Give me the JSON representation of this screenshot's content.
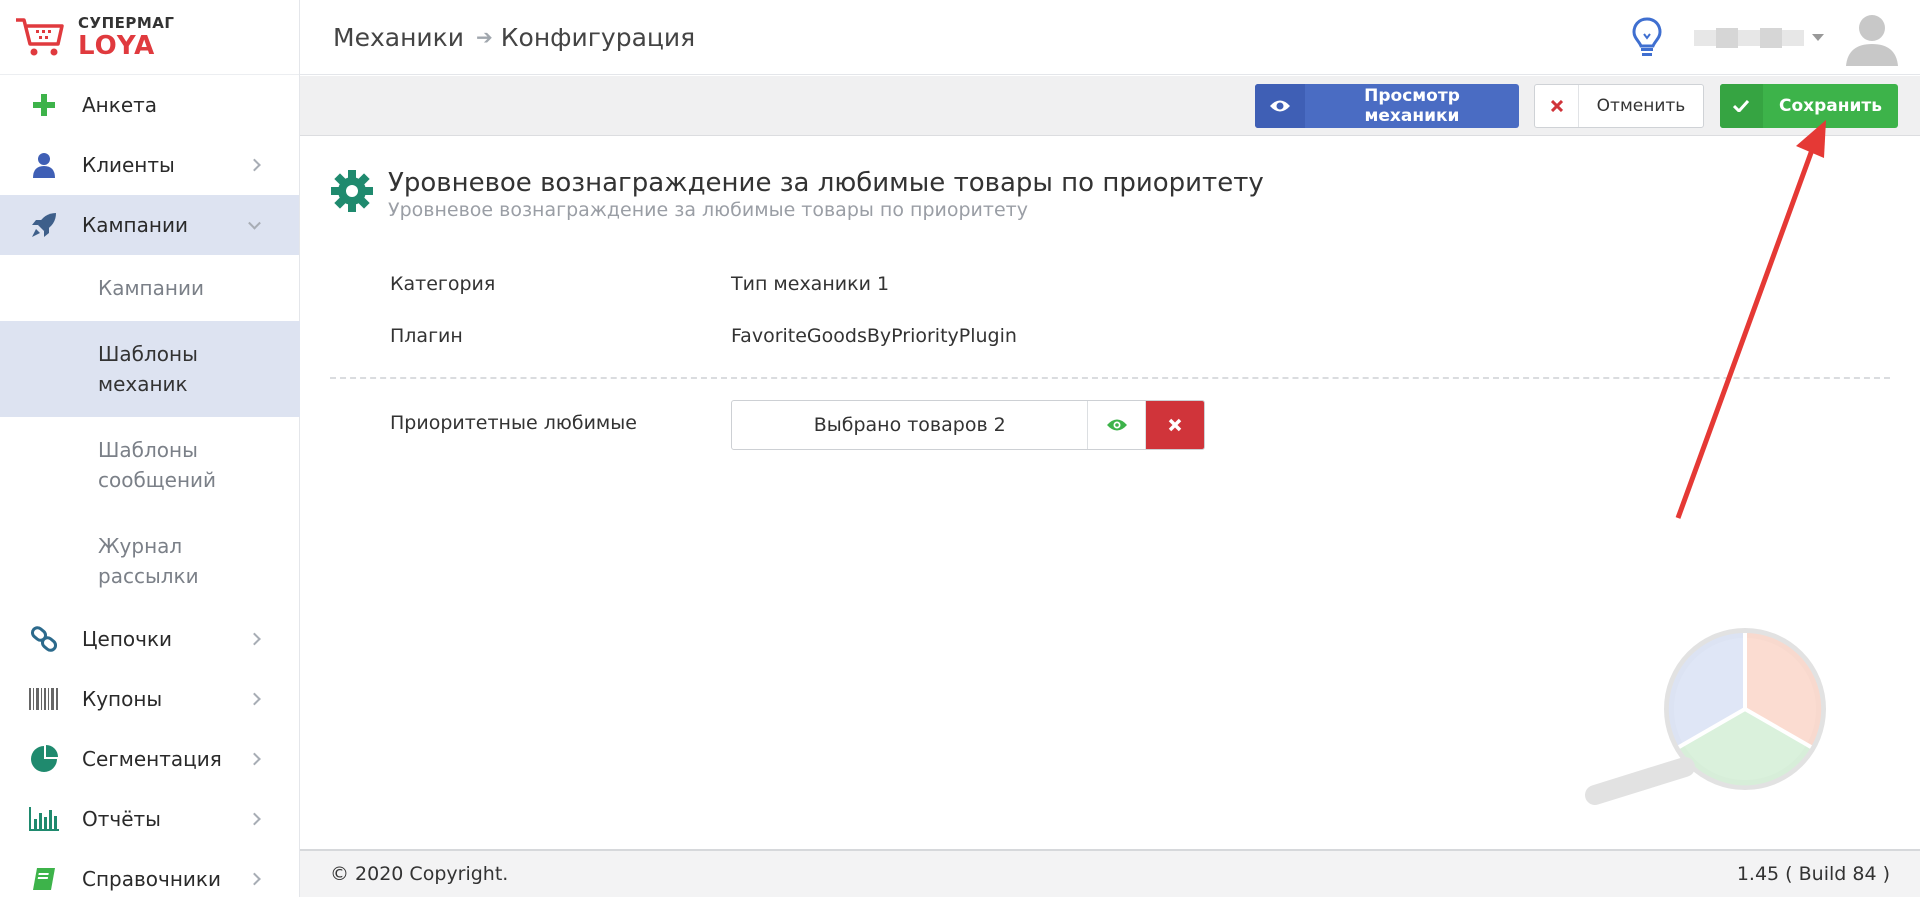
{
  "app": {
    "logo_top": "СУПЕРМАГ",
    "logo_bottom": "LOYA",
    "brand_color": "#e03a3e"
  },
  "sidebar": {
    "items": [
      {
        "label": "Анкета",
        "icon": "plus-icon",
        "color": "#3db34a",
        "has_chevron": false
      },
      {
        "label": "Клиенты",
        "icon": "user-icon",
        "color": "#3f5fb5",
        "has_chevron": true
      },
      {
        "label": "Кампании",
        "icon": "rocket-icon",
        "color": "#3e5f8a",
        "has_chevron": true,
        "active": true
      }
    ],
    "sub_items": [
      {
        "label": "Кампании"
      },
      {
        "label": "Шаблоны механик",
        "active": true
      },
      {
        "label": "Шаблоны сообщений"
      },
      {
        "label": "Журнал рассылки"
      }
    ],
    "items_after": [
      {
        "label": "Цепочки",
        "icon": "chain-icon",
        "color": "#2c6a8c"
      },
      {
        "label": "Купоны",
        "icon": "barcode-icon",
        "color": "#666"
      },
      {
        "label": "Сегментация",
        "icon": "pie-chart-icon",
        "color": "#1f8a6e"
      },
      {
        "label": "Отчёты",
        "icon": "bar-chart-icon",
        "color": "#1f8a6e"
      },
      {
        "label": "Справочники",
        "icon": "book-icon",
        "color": "#3db34a"
      }
    ]
  },
  "header": {
    "breadcrumb_first": "Механики",
    "breadcrumb_second": "Конфигурация"
  },
  "toolbar": {
    "view_label": "Просмотр механики",
    "cancel_label": "Отменить",
    "save_label": "Сохранить"
  },
  "main": {
    "title": "Уровневое вознаграждение за любимые товары по приоритету",
    "subtitle": "Уровневое вознаграждение за любимые товары по приоритету",
    "fields": [
      {
        "label": "Категория",
        "value": "Тип механики 1"
      },
      {
        "label": "Плагин",
        "value": "FavoriteGoodsByPriorityPlugin"
      }
    ],
    "priority_label": "Приоритетные любимые",
    "picker_label": "Выбрано товаров 2"
  },
  "footer": {
    "copyright": "© 2020 Copyright.",
    "version": "1.45 ( Build 84 )"
  },
  "colors": {
    "sidebar_active_bg": "#dde3f1",
    "primary_blue": "#4a6cc3",
    "success_green": "#3db34a",
    "danger_red": "#d0343a",
    "annotation_red": "#e53935"
  }
}
